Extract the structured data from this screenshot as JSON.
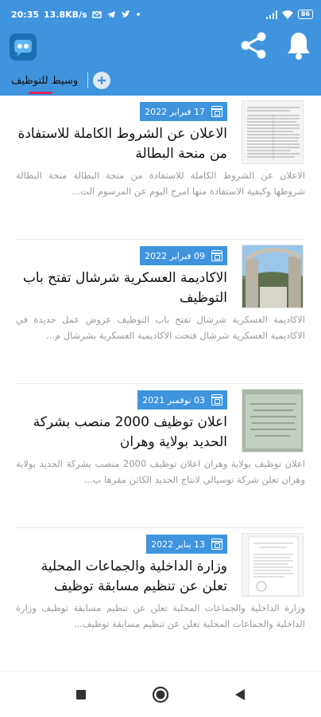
{
  "status_bar": {
    "time": "20:35",
    "network_speed": "13.8KB/s",
    "battery": "86"
  },
  "tabs": {
    "active_label": "وسيط للتوظيف"
  },
  "articles": [
    {
      "date": "17 فبراير 2022",
      "title": "الاعلان عن الشروط الكاملة للاستفادة من منحة البطالة",
      "excerpt": "الاعلان عن الشروط الكاملة للاستفادة من منحة البطالة منحة البطالة شروطها وكيفية الاستفادة منها امرج اليوم عن المرسوم الت..."
    },
    {
      "date": "09 فبراير 2022",
      "title": "الاكاديمة العسكرية شرشال تفتح باب التوظيف",
      "excerpt": "الاكاديمة العسكرية شرشال تفتح باب التوظيف عروض عمل جديدة في الاكاديمية العسكرية شرشال فتحت الاكاديمية العسكرية بشرشال م..."
    },
    {
      "date": "03 نوفمبر 2021",
      "title": "اعلان توظيف 2000 منصب بشركة الحديد بولاية وهران",
      "excerpt": "اعلان توظيف بولاية وهران اعلان توظيف 2000 منصب بشركة الحديد بولاية وهران تعلن شركة توسيالي لانتاج الحديد الكائن مقرها ب..."
    },
    {
      "date": "13 يناير 2022",
      "title": "وزارة الداخلية والجماعات المحلية تعلن عن تنظيم مسابقة توظيف",
      "excerpt": "وزارة الداخلية والجماعات المحلية تعلن عن تنظيم مسابقة توظيف وزارة الداخلية والجماعات المحلية تعلن عن تنظيم مسابقة توظيف..."
    }
  ],
  "colors": {
    "primary": "#3f94dd",
    "accent": "#e0245e"
  }
}
